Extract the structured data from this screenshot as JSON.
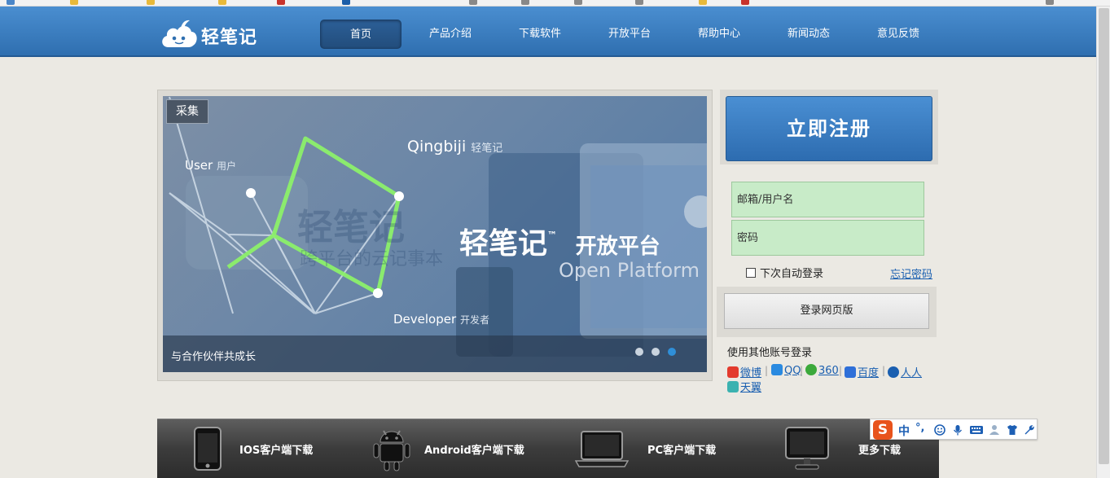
{
  "nav": {
    "logo_text": "轻笔记",
    "items": [
      {
        "label": "首页",
        "active": true
      },
      {
        "label": "产品介绍"
      },
      {
        "label": "下载软件"
      },
      {
        "label": "开放平台"
      },
      {
        "label": "帮助中心"
      },
      {
        "label": "新闻动态"
      },
      {
        "label": "意见反馈"
      }
    ]
  },
  "banner": {
    "collect_label": "采集",
    "user_label": "User",
    "user_cn": "用户",
    "qingbiji": "Qingbiji",
    "qingbiji_cn": "轻笔记",
    "developer_label": "Developer",
    "developer_cn": "开发者",
    "brand_cn": "轻笔记",
    "tm": "™",
    "platform_cn": "开放平台",
    "platform_en": "Open Platform",
    "bg_brand": "轻笔记",
    "bg_slogan": "跨平台的云记事本",
    "caption": "与合作伙伴共成长",
    "slides": 3,
    "active_slide": 3
  },
  "auth": {
    "register_label": "立即注册",
    "username_placeholder": "邮箱/用户名",
    "password_placeholder": "密码",
    "auto_login_label": "下次自动登录",
    "auto_login_checked": false,
    "forgot_label": "忘记密码",
    "login_label": "登录网页版",
    "other_title": "使用其他账号登录",
    "providers": [
      {
        "name": "微博",
        "color": "#e33a2d"
      },
      {
        "name": "QQ",
        "color": "#2a8ae0"
      },
      {
        "name": "360",
        "color": "#3ba93b"
      },
      {
        "name": "百度",
        "color": "#2e6fd8"
      },
      {
        "name": "人人",
        "color": "#1a5fb0"
      },
      {
        "name": "天翼",
        "color": "#3bb2b0"
      }
    ],
    "separator": "|"
  },
  "downloads": [
    {
      "label": "IOS客户端下载",
      "icon": "phone-icon"
    },
    {
      "label": "Android客户端下载",
      "icon": "android-icon"
    },
    {
      "label": "PC客户端下载",
      "icon": "laptop-icon"
    },
    {
      "label": "更多下载",
      "icon": "monitor-icon"
    }
  ],
  "ime": {
    "logo": "S",
    "mode": "中",
    "punct": "°,"
  },
  "colors": {
    "header": "#3a7fc2",
    "register": "#3a7fc2",
    "field_bg": "#c8ebc8",
    "download_bar": "#3c3c3c"
  }
}
